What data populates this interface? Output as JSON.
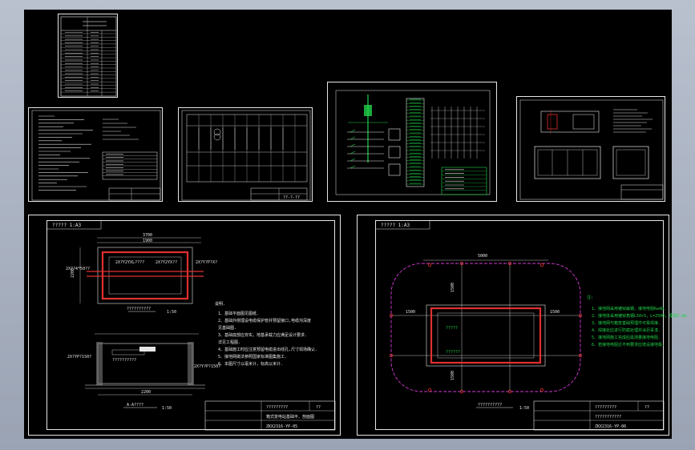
{
  "app": {
    "name": "CAD drawing viewer"
  },
  "sheets": {
    "left_bottom": {
      "header_tag": "????? 1:A3",
      "dims": {
        "top": "3700",
        "top_sub": "1900",
        "left": "2200",
        "bottom": "2200"
      },
      "labels": {
        "cable1": "2X?Y2YXL????",
        "cable2": "2X?Y2YX??",
        "wire_left": "2X??4*50??",
        "wire_right": "2X?Y?P?X?"
      },
      "plan_caption": "??????????",
      "plan_scale": "1:50",
      "section_caption": "A-A????",
      "section_scale": "1:50",
      "section_labels": {
        "left": "2X?YP?150?",
        "right": "2X?Y?P?150?",
        "note": "??????????"
      },
      "notes_title": "说明.",
      "notes": [
        "1、基础平面图见图纸.",
        "2、基础外侧埋设电缆保护管并预留接口,电缆沟深度",
        "   见基础图.",
        "3、基础底部应夯实，地基承载力应满足设计要求.",
        "   详见工程图.",
        "4、基础施工时应注意预留电缆进出线孔,尺寸现场确认.",
        "5、接地网做法参照国家标准图集施工.",
        "6、本图尺寸以毫米计，标高以米计."
      ],
      "titleblock": {
        "project": "?????????",
        "sheet_no": "??",
        "title": "箱式变电站基础平、剖面图",
        "drawing_no": "ZKX2316-YP-05"
      }
    },
    "right_bottom": {
      "header_tag": "????? 1:A3",
      "dims": {
        "top": "5000",
        "left": "1500",
        "right": "1500",
        "vert_top": "1500",
        "vert_bottom": "1500"
      },
      "labels": {
        "l1": "?????",
        "l2": "??????"
      },
      "caption": "??????????",
      "scale": "1:50",
      "notes_title": "注:",
      "notes": [
        "1、接地网采用镀锌扁钢，接地电阻R≤4Ω.",
        "2、接地体采用镀锌角钢L50×5，L=2500，埋深0.8m.",
        "3、接地网与箱变基础预埋件可靠焊接.",
        "4、焊接处应进行防腐处理并涂沥青漆.",
        "5、接地网施工完成后需测量接地电阻.",
        "6、若接地电阻达不到要求应增设接地极."
      ],
      "titleblock": {
        "project": "?????????",
        "sheet_no": "??",
        "title": "???????????",
        "drawing_no": "ZKX2316-YP-06"
      }
    },
    "top_sheets": {
      "sheet3_title": "?????????",
      "sheet2_title": "??-?-??"
    }
  }
}
